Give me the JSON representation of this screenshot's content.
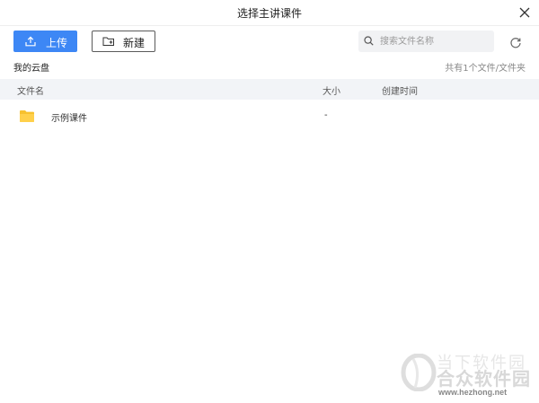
{
  "dialog": {
    "title": "选择主讲课件",
    "close_icon": "close-icon"
  },
  "toolbar": {
    "upload_label": "上传",
    "upload_icon": "upload-icon",
    "new_label": "新建",
    "new_icon": "new-folder-icon",
    "search_placeholder": "搜索文件名称",
    "search_value": "",
    "refresh_icon": "refresh-icon",
    "accent_color": "#3d87f5"
  },
  "breadcrumb": {
    "current": "我的云盘",
    "count_text": "共有1个文件/文件夹"
  },
  "table": {
    "columns": [
      "文件名",
      "大小",
      "创建时间"
    ],
    "rows": [
      {
        "icon": "folder-icon",
        "name": "示例课件",
        "size": "-",
        "created": ""
      }
    ]
  },
  "watermark": {
    "line1": "当下软件园",
    "line2": "合众软件园",
    "url": "www.hezhong.net"
  }
}
